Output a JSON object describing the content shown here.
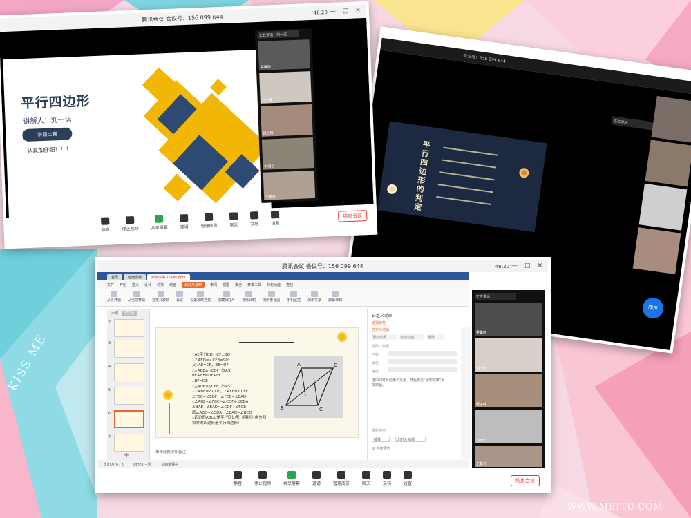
{
  "watermarks": {
    "left": "KISS ME",
    "right": "WWW.MEITU.COM"
  },
  "shot1": {
    "meeting_title": "腾讯会议  会议号：156 099 644",
    "time": "46:20",
    "slide": {
      "title": "平行四边形",
      "subtitle": "讲解人：刘一诺",
      "pill": "讲题比赛",
      "note": "认真加仔细！！！"
    },
    "speaking": "正在讲话：刘一诺",
    "toolbar": [
      "静音",
      "停止视频",
      "共享屏幕",
      "邀请",
      "管理成员",
      "聊天",
      "文档",
      "设置"
    ],
    "end_button": "结束会议"
  },
  "shot2": {
    "meeting_id": "会议号：156 099 644",
    "slide_title": "平行四边形的判定",
    "speaking": "正在讲话：",
    "button": "同声"
  },
  "shot3": {
    "meeting_title": "腾讯会议  会议号：156 099 644",
    "time": "46:20",
    "tabs": [
      "首页",
      "稻壳模板",
      "数学讲题-刘子韩.pptx"
    ],
    "menu": [
      "文件",
      "开始",
      "插入",
      "设计",
      "切换",
      "动画",
      "幻灯片放映",
      "审阅",
      "视图",
      "安全",
      "开发工具",
      "特色功能",
      "查找"
    ],
    "ribbon": [
      "从头开始",
      "从当前开始",
      "自定义放映",
      "会议",
      "设置放映方式",
      "隐藏幻灯片",
      "排练计时",
      "演示者视图",
      "手机遥控",
      "演示实录",
      "屏幕录制"
    ],
    "thumbs_header": [
      "大纲",
      "幻灯片"
    ],
    "slide_numbers": [
      "2",
      "3",
      "4",
      "5",
      "6",
      "7"
    ],
    "proof_lines": [
      "∵AE平分BD，CF⊥BD",
      "∴∠AED=∠CFB=90°",
      "又∵AE=CF，BE=DF",
      "∴△ABE≌△CDF（SAS）",
      "BE+EF=DF+EF",
      "∴BF=DE",
      "∴△ADE≌△CFB（SAS）",
      "∴∠ABE=∠CDF，∠AFE=∠CEF",
      "∠FBC=∠EDF，∠FCB=∠EAD",
      "∴∠ABE+∠FBC=∠CDF+∠EDA",
      "∠BAE+∠EAD=∠CDF+∠FCB",
      "即∠ABC=∠CDA，∠BAD=∠BCD",
      "∴四边形ABCD是平行四边形（两组对角分别相等的四边形是平行四边形）"
    ],
    "pane": {
      "title": "自定义动画",
      "select": "选择窗格",
      "custom": "自定义动画",
      "add_effect": "添加效果",
      "smart": "智能动画",
      "delete": "删除",
      "modify": "修改：效果",
      "start": "开始",
      "property": "属性",
      "speed": "速度",
      "hint": "选中幻灯片的某个元素，然后单击“添加效果”添加动画。",
      "reorder": "重新排序",
      "play": "播放",
      "slideshow": "幻灯片播放",
      "autopreview": "自动预览"
    },
    "notes": "单击此处添加备注",
    "status": [
      "幻灯片 6 / 8",
      "Office 主题",
      "文档未保护"
    ],
    "speaking": "正在讲话：",
    "toolbar": [
      "静音",
      "停止视频",
      "共享屏幕",
      "邀请",
      "管理成员",
      "聊天",
      "文档",
      "设置"
    ],
    "end_button": "结束会议"
  },
  "video_labels": [
    "霍馨瑶",
    "刘一诺",
    "顾子韩",
    "刘雨宁",
    "王紫轩",
    "李雨涵"
  ]
}
